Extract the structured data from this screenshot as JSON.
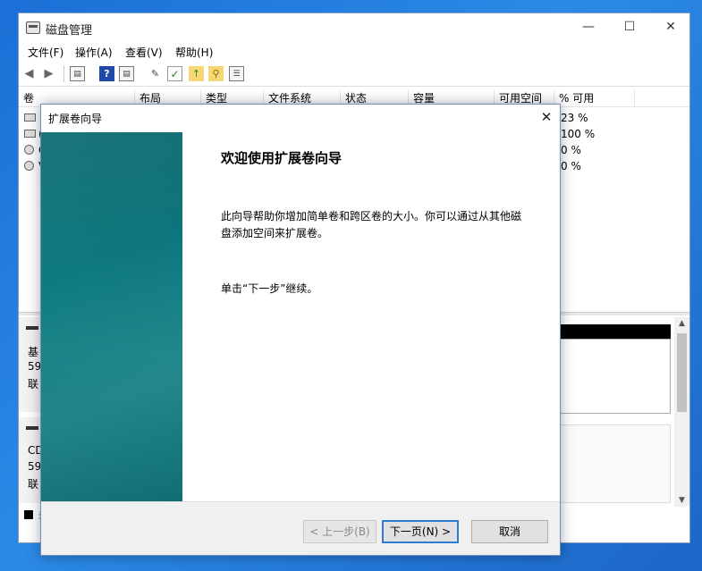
{
  "main_window": {
    "title": "磁盘管理",
    "controls": {
      "minimize": "—",
      "maximize": "☐",
      "close": "✕"
    },
    "menu": [
      "文件(F)",
      "操作(A)",
      "查看(V)",
      "帮助(H)"
    ],
    "toolbar_icons": [
      "back-arrow-icon",
      "forward-arrow-icon",
      "console-icon",
      "help-icon",
      "properties-icon",
      "rescan-icon",
      "check-icon",
      "upload-icon",
      "search-icon",
      "list-icon"
    ],
    "columns": [
      "卷",
      "布局",
      "类型",
      "文件系统",
      "状态",
      "容量",
      "可用空间",
      "% 可用"
    ],
    "volumes": [
      {
        "name": "",
        "pct": "23 %"
      },
      {
        "name": "(",
        "pct": "100 %"
      },
      {
        "name": "C",
        "pct": "0 %"
      },
      {
        "name": "V",
        "pct": "0 %"
      }
    ],
    "disks": [
      {
        "line1": "基",
        "line2": "59",
        "line3": "联"
      },
      {
        "line1": "CD",
        "line2": "59",
        "line3": "联"
      }
    ],
    "legend_text": "未"
  },
  "wizard": {
    "title": "扩展卷向导",
    "close": "✕",
    "heading": "欢迎使用扩展卷向导",
    "paragraph": "此向导帮助你增加简单卷和跨区卷的大小。你可以通过从其他磁盘添加空间来扩展卷。",
    "hint": "单击“下一步”继续。",
    "buttons": {
      "back": "< 上一步(B)",
      "next": "下一页(N) >",
      "cancel": "取消"
    }
  }
}
